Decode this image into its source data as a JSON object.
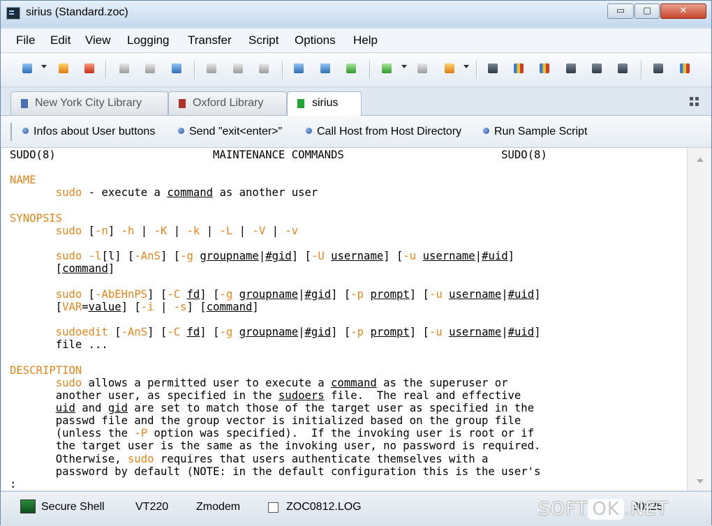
{
  "window": {
    "title": "sirius (Standard.zoc)"
  },
  "titlebar": {
    "minimize": "▭",
    "maximize": "▢",
    "close": "✕"
  },
  "menu": [
    "File",
    "Edit",
    "View",
    "Logging",
    "Transfer",
    "Script",
    "Options",
    "Help"
  ],
  "tabs": [
    {
      "label": "New York City Library",
      "color": "#4a6fb0",
      "active": false
    },
    {
      "label": "Oxford Library",
      "color": "#b0332b",
      "active": false
    },
    {
      "label": "sirius",
      "color": "#22a632",
      "active": true
    }
  ],
  "user_buttons": [
    "Infos about User buttons",
    "Send \"exit<enter>\"",
    "Call Host from Host Directory",
    "Run Sample Script"
  ],
  "terminal": {
    "accent_color": "#e8851a",
    "lines": [
      "SUDO(8)                        MAINTENANCE COMMANDS                        SUDO(8)",
      "",
      "NAME",
      "       sudo - execute a command as another user",
      "",
      "SYNOPSIS",
      "       sudo [-n] -h | -K | -k | -L | -V | -v",
      "",
      "       sudo -l[l] [-AnS] [-g groupname|#gid] [-U username] [-u username|#uid]",
      "       [command]",
      "",
      "       sudo [-AbEHnPS] [-C fd] [-g groupname|#gid] [-p prompt] [-u username|#uid]",
      "       [VAR=value] [-i | -s] [command]",
      "",
      "       sudoedit [-AnS] [-C fd] [-g groupname|#gid] [-p prompt] [-u username|#uid]",
      "       file ...",
      "",
      "DESCRIPTION",
      "       sudo allows a permitted user to execute a command as the superuser or",
      "       another user, as specified in the sudoers file.  The real and effective",
      "       uid and gid are set to match those of the target user as specified in the",
      "       passwd file and the group vector is initialized based on the group file",
      "       (unless the -P option was specified).  If the invoking user is root or if",
      "       the target user is the same as the invoking user, no password is required.",
      "       Otherwise, sudo requires that users authenticate themselves with a",
      "       password by default (NOTE: in the default configuration this is the user's",
      ":"
    ]
  },
  "status": {
    "connection": "Secure Shell",
    "emulation": "VT220",
    "transfer": "Zmodem",
    "log_file": "ZOC0812.LOG",
    "terminal_size": "80x25"
  },
  "watermark": {
    "prefix": "SOFT",
    "box": "OK",
    "suffix": ".NET"
  }
}
